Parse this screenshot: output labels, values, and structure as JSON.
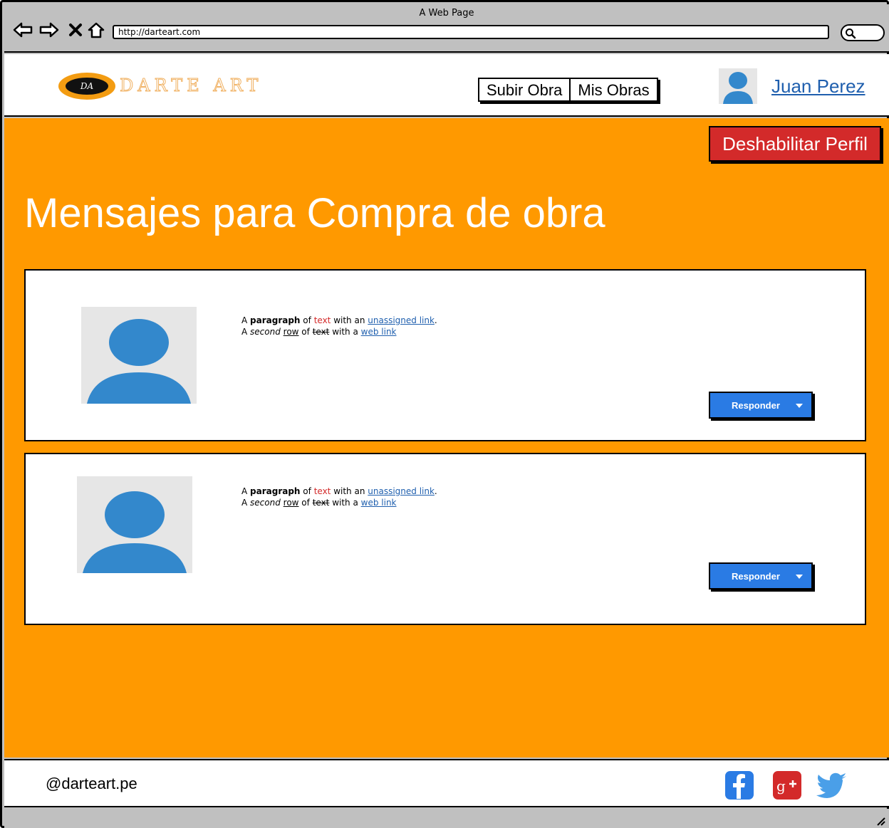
{
  "browser": {
    "window_title": "A Web Page",
    "url": "http://darteart.com"
  },
  "header": {
    "logo_badge": "DA",
    "logo_text": "DARTE ART",
    "nav": [
      "Subir Obra",
      "Mis Obras"
    ],
    "user_name": "Juan Perez"
  },
  "main": {
    "disable_button": "Deshabilitar Perfil",
    "title": "Mensajes para Compra de obra",
    "messages": [
      {
        "line1": {
          "a": "A ",
          "bold": "paragraph",
          "b": " of ",
          "red": "text",
          "c": " with an ",
          "link": "unassigned link",
          "d": "."
        },
        "line2": {
          "a": "A ",
          "italic": "second",
          "b": " ",
          "underline": "row",
          "c": " of ",
          "strike": "text",
          "d": " with a ",
          "link": "web link"
        },
        "reply_label": "Responder"
      },
      {
        "line1": {
          "a": "A ",
          "bold": "paragraph",
          "b": " of ",
          "red": "text",
          "c": " with an ",
          "link": "unassigned link",
          "d": "."
        },
        "line2": {
          "a": "A ",
          "italic": "second",
          "b": " ",
          "underline": "row",
          "c": " of ",
          "strike": "text",
          "d": " with a ",
          "link": "web link"
        },
        "reply_label": "Responder"
      }
    ]
  },
  "footer": {
    "handle": "@darteart.pe",
    "social_icons": [
      "facebook-icon",
      "google-plus-icon",
      "twitter-icon"
    ]
  },
  "colors": {
    "accent_orange": "#ff9900",
    "danger_red": "#d32a2a",
    "button_blue": "#2a7be4",
    "link_blue": "#1f5fae"
  }
}
